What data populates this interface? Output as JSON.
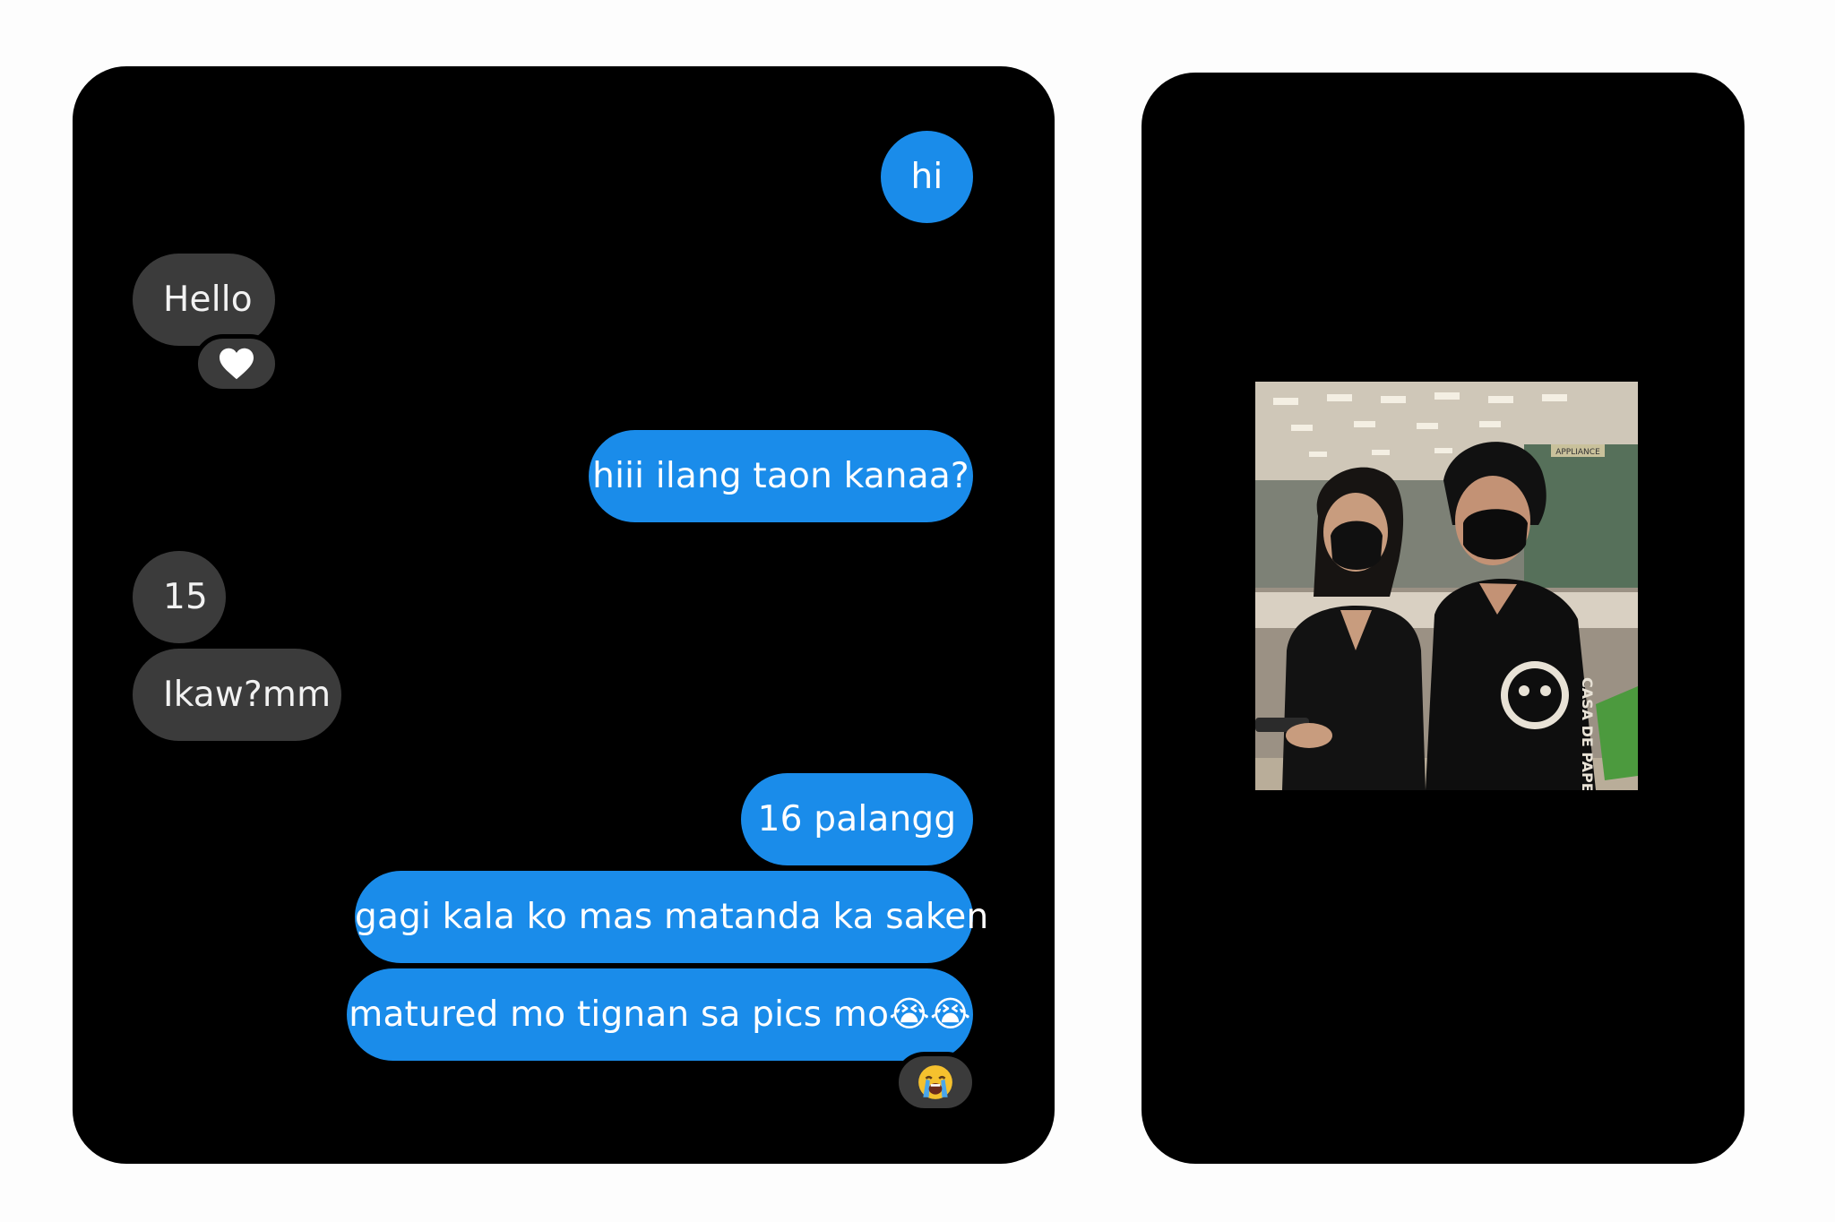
{
  "conversation": {
    "messages": [
      {
        "from": "me",
        "text": "hi"
      },
      {
        "from": "them",
        "text": "Hello",
        "reaction": "white-heart"
      },
      {
        "from": "me",
        "text": "hiii ilang taon kanaa?"
      },
      {
        "from": "them",
        "text": "15"
      },
      {
        "from": "them",
        "text": "Ikaw?mm"
      },
      {
        "from": "me",
        "text": "16 palangg"
      },
      {
        "from": "me",
        "text": "gagi kala ko mas matanda ka saken"
      },
      {
        "from": "me",
        "text": "matured mo tignan sa pics mo😭😭",
        "reaction": "loudly-crying-face"
      }
    ]
  },
  "photo_panel": {
    "shirt_print": "CASA DE PAPEL",
    "store_sign": "APPLIANCE"
  },
  "colors": {
    "sent_bubble": "#1a8cea",
    "received_bubble": "#3b3b3b",
    "panel_background": "#000000",
    "page_background": "#fdfdfd"
  }
}
